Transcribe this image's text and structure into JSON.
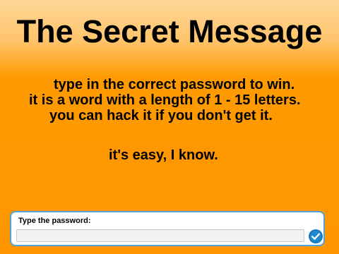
{
  "title": "The Secret Message",
  "message": {
    "line1": "type in the correct password to win.",
    "line2": "it is a word with a length of 1 - 15 letters.",
    "line3": "you can hack it if you don't get it.",
    "line4": "it's easy, I know."
  },
  "ask": {
    "label": "Type the password:",
    "value": "",
    "submit_icon": "checkmark-icon"
  },
  "colors": {
    "background_top": "#ffd79a",
    "background_bottom": "#ff9600",
    "prompt_border": "#4fa3dc",
    "submit_button": "#1b88d0"
  }
}
